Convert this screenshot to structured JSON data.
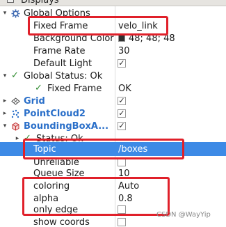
{
  "panel": {
    "title": "Displays"
  },
  "global_options": {
    "label": "Global Options",
    "fixed_frame": {
      "label": "Fixed Frame",
      "value": "velo_link"
    },
    "background_color": {
      "label": "Background Color",
      "value": "48; 48; 48",
      "swatch": "#303030"
    },
    "frame_rate": {
      "label": "Frame Rate",
      "value": "30"
    },
    "default_light": {
      "label": "Default Light",
      "checked": true
    }
  },
  "global_status": {
    "label": "Global Status: Ok",
    "fixed_frame": {
      "label": "Fixed Frame",
      "value": "OK"
    }
  },
  "displays": [
    {
      "label": "Grid",
      "checked": true
    },
    {
      "label": "PointCloud2",
      "checked": true
    },
    {
      "label": "BoundingBoxA...",
      "checked": true
    }
  ],
  "bbox_props": {
    "status": "Status: Ok",
    "topic": {
      "label": "Topic",
      "value": "/boxes"
    },
    "unreliable": {
      "label": "Unreliable",
      "checked": false
    },
    "queue_size": {
      "label": "Queue Size",
      "value": "10"
    },
    "coloring": {
      "label": "coloring",
      "value": "Auto"
    },
    "alpha": {
      "label": "alpha",
      "value": "0.8"
    },
    "only_edge": {
      "label": "only edge",
      "checked": false
    },
    "show_coords": {
      "label": "show coords",
      "checked": false
    }
  },
  "watermark": "CSDN @WayYip",
  "colors": {
    "selection": "#3d8ae6",
    "highlight_box": "#e0202a",
    "link_blue": "#2a6fc9",
    "status_green": "#2e8b2e"
  }
}
